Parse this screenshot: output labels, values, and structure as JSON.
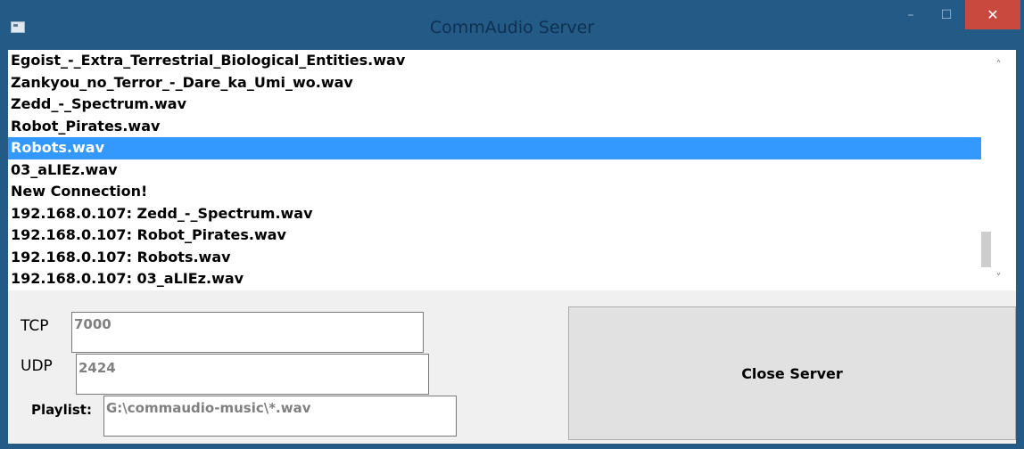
{
  "window": {
    "title": "CommAudio Server",
    "minimize_glyph": "–",
    "maximize_glyph": "☐",
    "close_glyph": "✕"
  },
  "log": {
    "items": [
      "Egoist_-_Extra_Terrestrial_Biological_Entities.wav",
      "Zankyou_no_Terror_-_Dare_ka_Umi_wo.wav",
      "Zedd_-_Spectrum.wav",
      "Robot_Pirates.wav",
      "Robots.wav",
      "03_aLIEz.wav",
      "New Connection!",
      "192.168.0.107: Zedd_-_Spectrum.wav",
      "192.168.0.107: Robot_Pirates.wav",
      "192.168.0.107: Robots.wav",
      "192.168.0.107: 03_aLIEz.wav"
    ],
    "selected_index": 4,
    "scroll_up_glyph": "˄",
    "scroll_down_glyph": "˅"
  },
  "settings": {
    "tcp_label": "TCP",
    "tcp_value": "7000",
    "udp_label": "UDP",
    "udp_value": "2424",
    "playlist_label": "Playlist:",
    "playlist_value": "G:\\commaudio-music\\*.wav"
  },
  "actions": {
    "close_server_label": "Close Server"
  },
  "colors": {
    "titlebar": "#245a86",
    "selection": "#3399ff",
    "close_button": "#c9493e"
  }
}
